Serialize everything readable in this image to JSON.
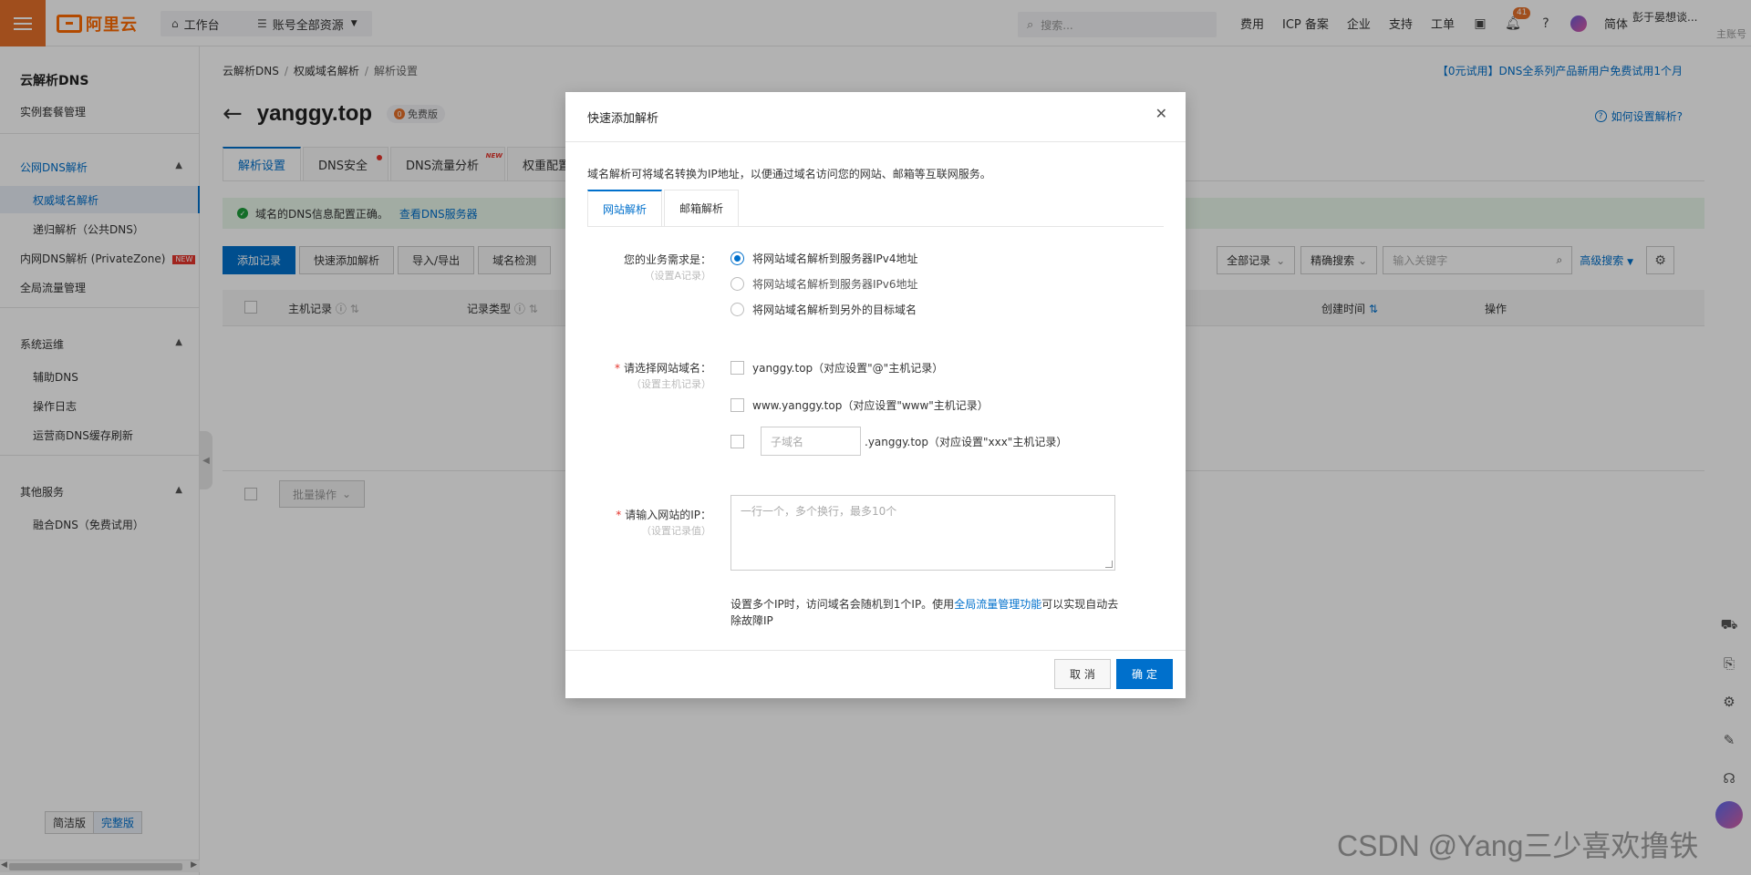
{
  "topbar": {
    "logo": "阿里云",
    "workbench": "工作台",
    "resource_scope": "账号全部资源",
    "search_placeholder": "搜索...",
    "links": [
      "费用",
      "ICP 备案",
      "企业",
      "支持",
      "工单"
    ],
    "notification_count": "41",
    "language": "简体",
    "user_name": "彭于晏想谈...",
    "user_role": "主账号"
  },
  "sidebar": {
    "title": "云解析DNS",
    "instance_mgmt": "实例套餐管理",
    "group_public": "公网DNS解析",
    "item_authoritative": "权威域名解析",
    "item_recursive": "递归解析（公共DNS）",
    "item_private": "内网DNS解析 (PrivateZone)",
    "new_badge": "NEW",
    "item_gtm": "全局流量管理",
    "group_ops": "系统运维",
    "item_aux": "辅助DNS",
    "item_oplog": "操作日志",
    "item_cache": "运营商DNS缓存刷新",
    "group_other": "其他服务",
    "item_fusion": "融合DNS（免费试用）",
    "ver_simple": "简洁版",
    "ver_full": "完整版"
  },
  "main": {
    "breadcrumb": [
      "云解析DNS",
      "权威域名解析",
      "解析设置"
    ],
    "promo": "【0元试用】DNS全系列产品新用户免费试用1个月",
    "domain": "yanggy.top",
    "edition": "免费版",
    "howto": "如何设置解析?",
    "tabs": [
      "解析设置",
      "DNS安全",
      "DNS流量分析",
      "权重配置"
    ],
    "tab_new": "NEW",
    "alert_text": "域名的DNS信息配置正确。",
    "alert_link": "查看DNS服务器",
    "buttons": [
      "添加记录",
      "快速添加解析",
      "导入/导出",
      "域名检测"
    ],
    "filter_all": "全部记录",
    "filter_exact": "精确搜索",
    "keyword_placeholder": "输入关键字",
    "advanced": "高级搜索",
    "columns": {
      "host": "主机记录",
      "type": "记录类型",
      "created": "创建时间",
      "action": "操作"
    },
    "batch": "批量操作"
  },
  "dialog": {
    "title": "快速添加解析",
    "description": "域名解析可将域名转换为IP地址，以便通过域名访问您的网站、邮箱等互联网服务。",
    "tabs": [
      "网站解析",
      "邮箱解析"
    ],
    "need_label": "您的业务需求是：",
    "need_hint": "（设置A记录）",
    "options": [
      "将网站域名解析到服务器IPv4地址",
      "将网站域名解析到服务器IPv6地址",
      "将网站域名解析到另外的目标域名"
    ],
    "selected_option": 0,
    "domain_label": "请选择网站域名：",
    "domain_hint": "（设置主机记录）",
    "domain_opt1": "yanggy.top（对应设置\"@\"主机记录）",
    "domain_opt2": "www.yanggy.top（对应设置\"www\"主机记录）",
    "subdomain_placeholder": "子域名",
    "domain_opt3_suffix": ".yanggy.top（对应设置\"xxx\"主机记录）",
    "ip_label": "请输入网站的IP：",
    "ip_hint": "（设置记录值）",
    "ip_placeholder": "一行一个，多个换行，最多10个",
    "ip_note_pre": "设置多个IP时，访问域名会随机到1个IP。使用",
    "ip_note_link": "全局流量管理功能",
    "ip_note_post": "可以实现自动去除故障IP",
    "cancel": "取 消",
    "confirm": "确 定"
  },
  "watermark": "CSDN @Yang三少喜欢撸铁"
}
